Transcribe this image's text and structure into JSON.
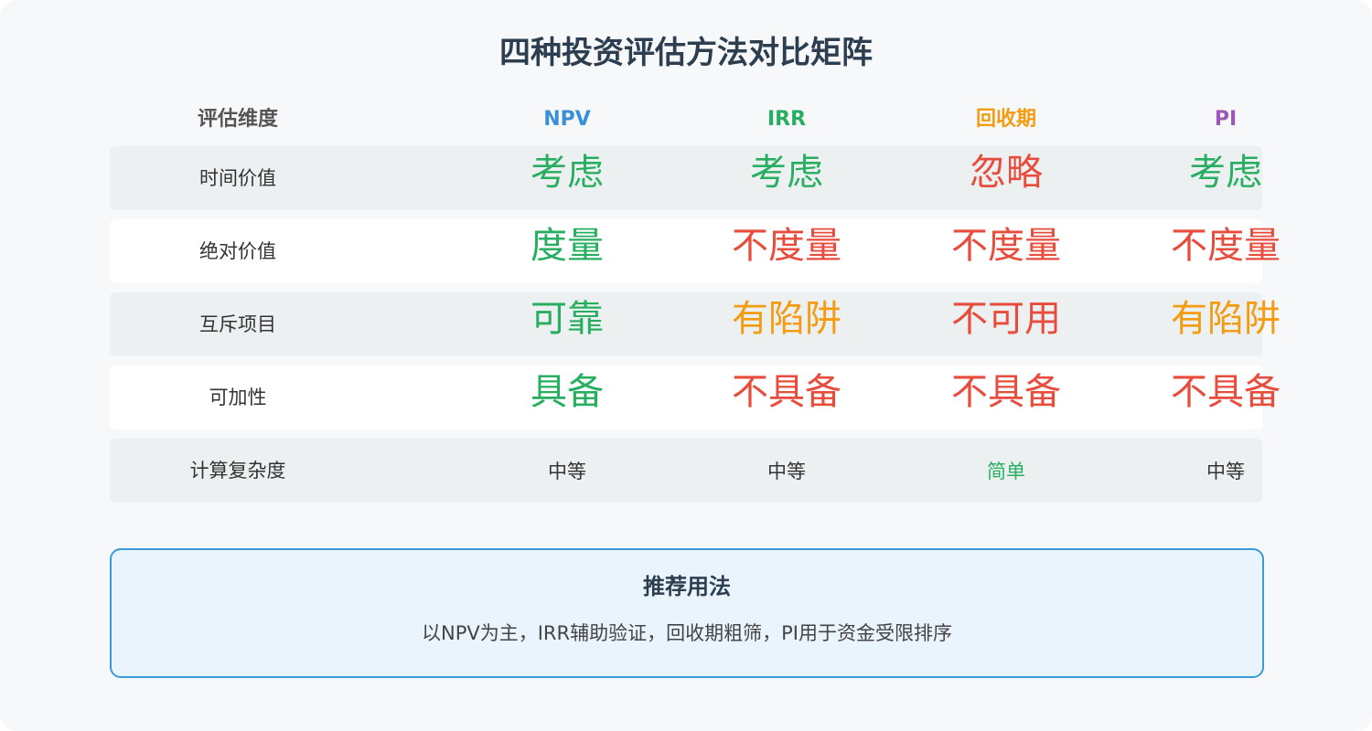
{
  "title": "四种投资评估方法对比矩阵",
  "header": {
    "dimension_label": "评估维度",
    "methods": [
      {
        "label": "NPV",
        "color": "#3a8fd9"
      },
      {
        "label": "IRR",
        "color": "#27ae60"
      },
      {
        "label": "回收期",
        "color": "#f39c12"
      },
      {
        "label": "PI",
        "color": "#9b59b6"
      }
    ]
  },
  "rows": [
    {
      "label": "时间价值",
      "cells": [
        {
          "text": "考虑",
          "color": "#27ae60"
        },
        {
          "text": "考虑",
          "color": "#27ae60"
        },
        {
          "text": "忽略",
          "color": "#e74c3c"
        },
        {
          "text": "考虑",
          "color": "#27ae60"
        }
      ]
    },
    {
      "label": "绝对价值",
      "cells": [
        {
          "text": "度量",
          "color": "#27ae60"
        },
        {
          "text": "不度量",
          "color": "#e74c3c"
        },
        {
          "text": "不度量",
          "color": "#e74c3c"
        },
        {
          "text": "不度量",
          "color": "#e74c3c"
        }
      ]
    },
    {
      "label": "互斥项目",
      "cells": [
        {
          "text": "可靠",
          "color": "#27ae60"
        },
        {
          "text": "有陷阱",
          "color": "#f39c12"
        },
        {
          "text": "不可用",
          "color": "#e74c3c"
        },
        {
          "text": "有陷阱",
          "color": "#f39c12"
        }
      ]
    },
    {
      "label": "可加性",
      "cells": [
        {
          "text": "具备",
          "color": "#27ae60"
        },
        {
          "text": "不具备",
          "color": "#e74c3c"
        },
        {
          "text": "不具备",
          "color": "#e74c3c"
        },
        {
          "text": "不具备",
          "color": "#e74c3c"
        }
      ]
    },
    {
      "label": "计算复杂度",
      "cells": [
        {
          "text": "中等",
          "color": "#333333"
        },
        {
          "text": "中等",
          "color": "#333333"
        },
        {
          "text": "简单",
          "color": "#27ae60"
        },
        {
          "text": "中等",
          "color": "#333333"
        }
      ]
    }
  ],
  "recommendation": {
    "title": "推荐用法",
    "text": "以NPV为主，IRR辅助验证，回收期粗筛，PI用于资金受限排序"
  }
}
